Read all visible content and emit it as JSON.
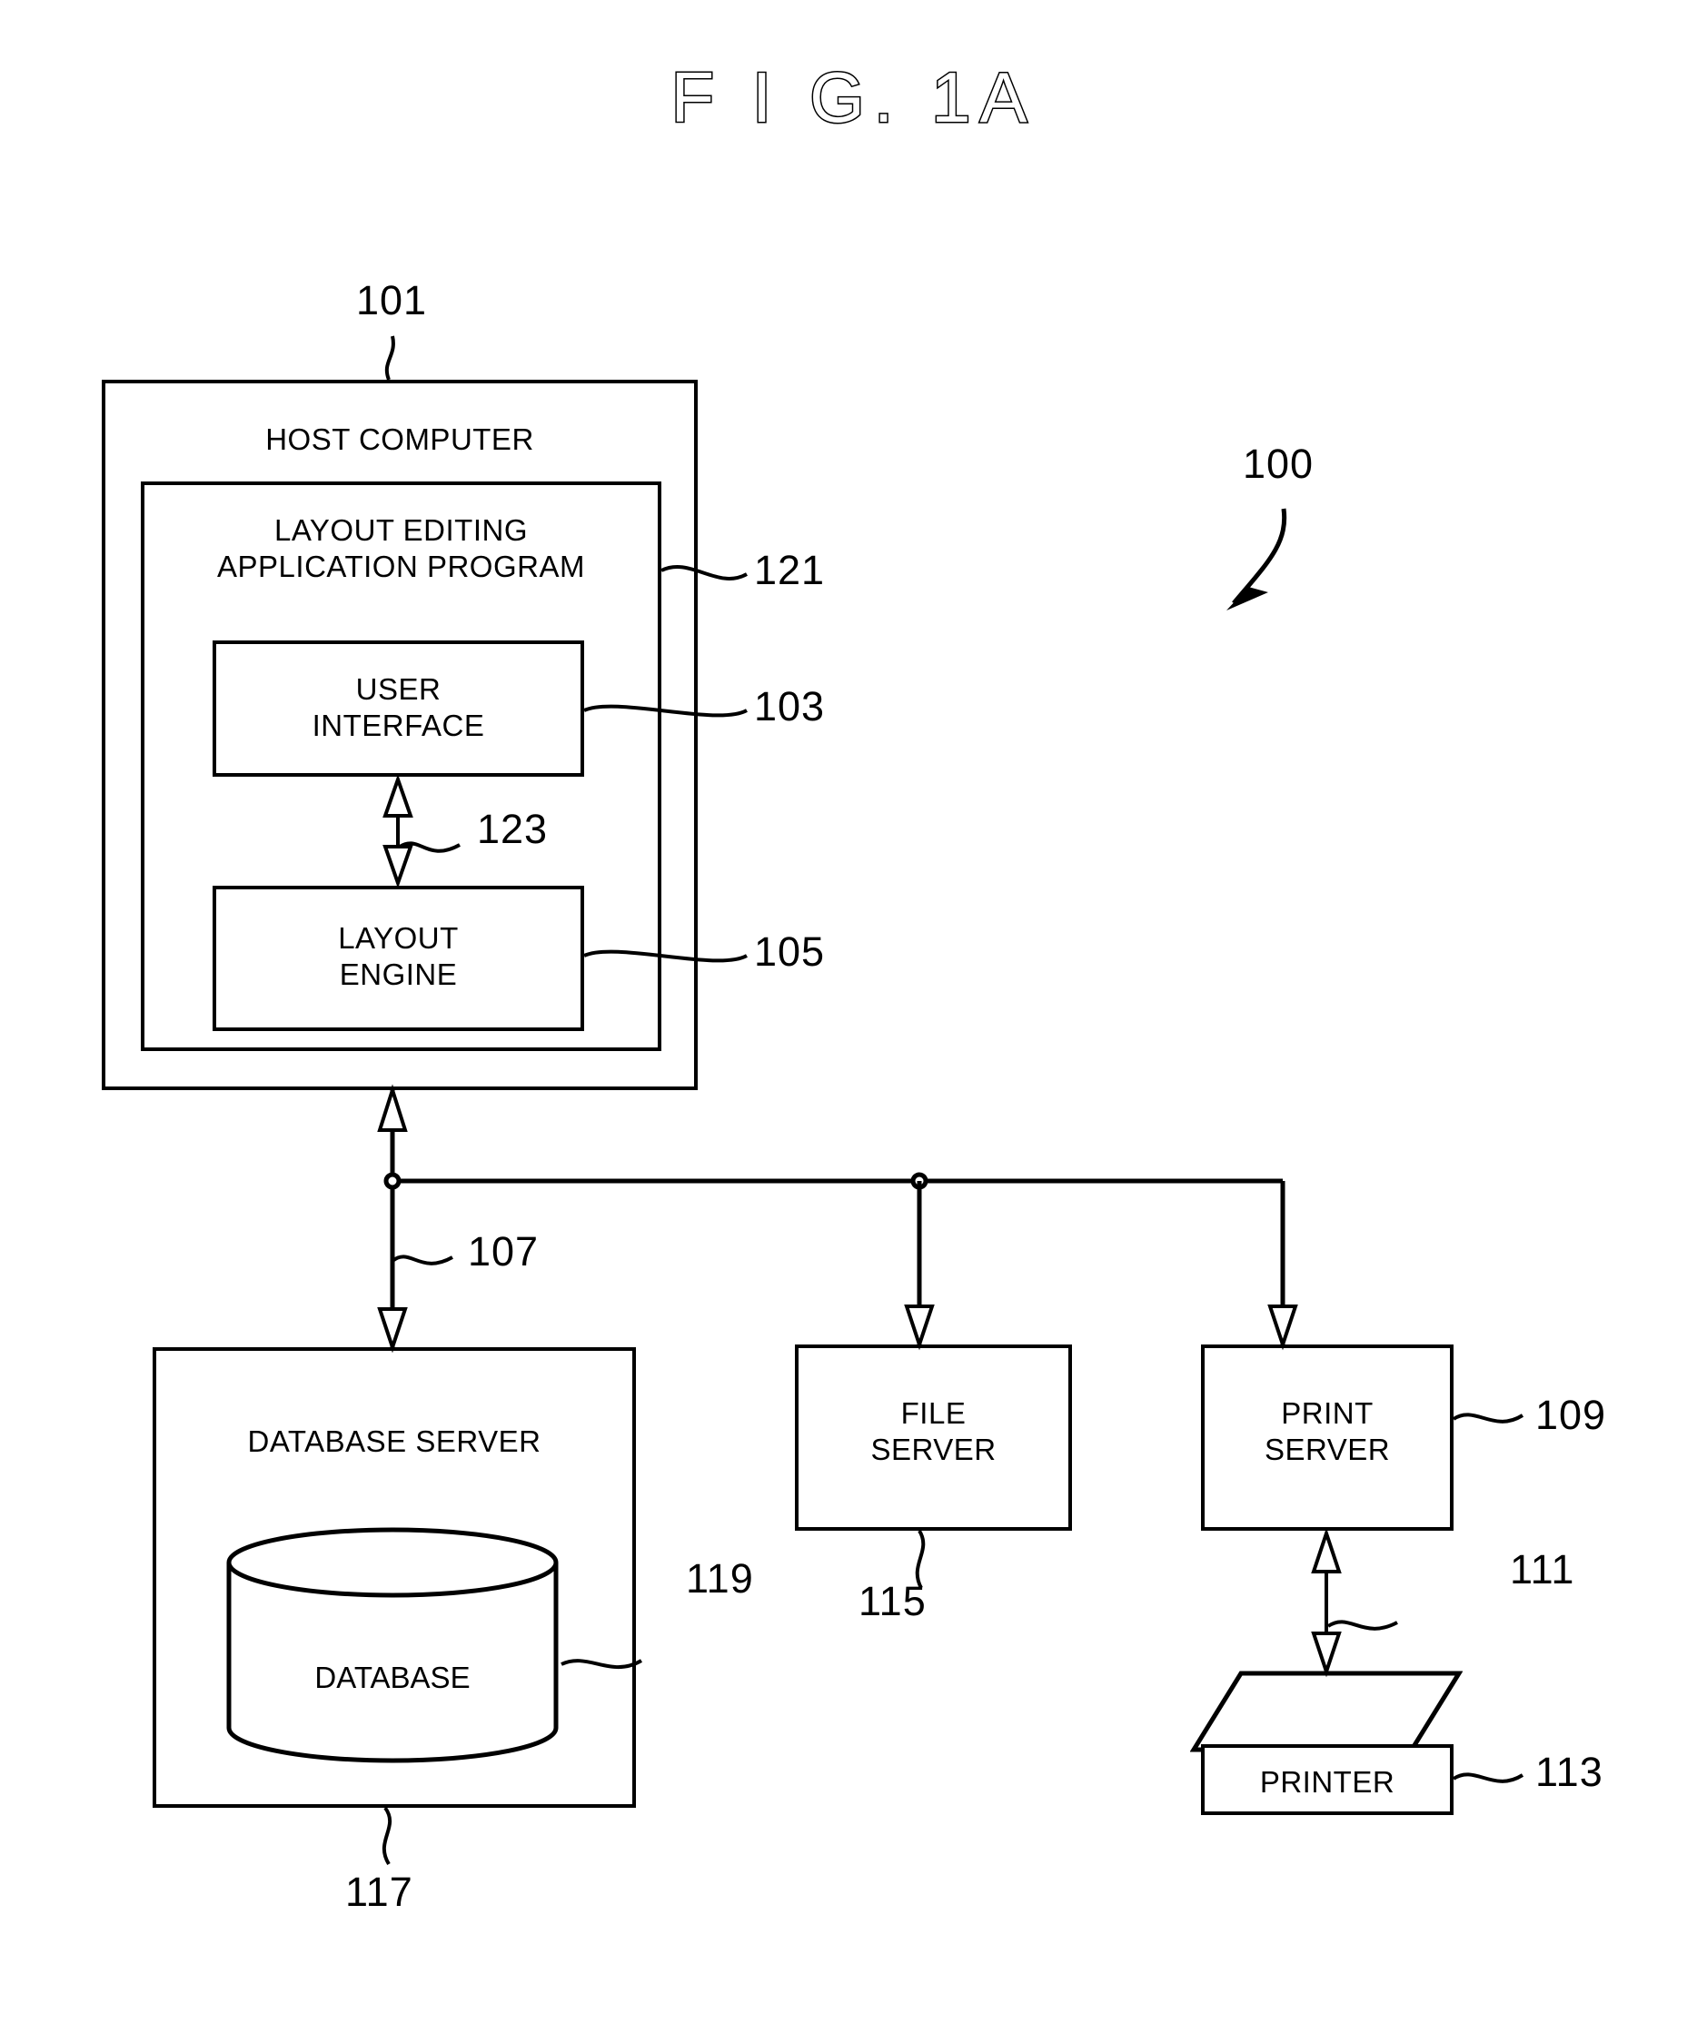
{
  "figure": {
    "title": "F I G.  1A",
    "system_ref": "100"
  },
  "host": {
    "label": "HOST COMPUTER",
    "ref": "101",
    "application": {
      "label_line1": "LAYOUT EDITING",
      "label_line2": "APPLICATION PROGRAM",
      "ref": "121"
    },
    "user_interface": {
      "label_line1": "USER",
      "label_line2": "INTERFACE",
      "ref": "103"
    },
    "layout_engine": {
      "label_line1": "LAYOUT",
      "label_line2": "ENGINE",
      "ref": "105"
    },
    "internal_link_ref": "123"
  },
  "network": {
    "ref": "107"
  },
  "database_server": {
    "label": "DATABASE SERVER",
    "ref": "117",
    "database": {
      "label": "DATABASE",
      "ref": "119"
    }
  },
  "file_server": {
    "label_line1": "FILE",
    "label_line2": "SERVER",
    "ref": "115"
  },
  "print_server": {
    "label_line1": "PRINT",
    "label_line2": "SERVER",
    "ref": "109"
  },
  "printer": {
    "label": "PRINTER",
    "ref": "113",
    "link_ref": "111"
  },
  "colors": {
    "ink": "#000000",
    "paper": "#ffffff"
  }
}
